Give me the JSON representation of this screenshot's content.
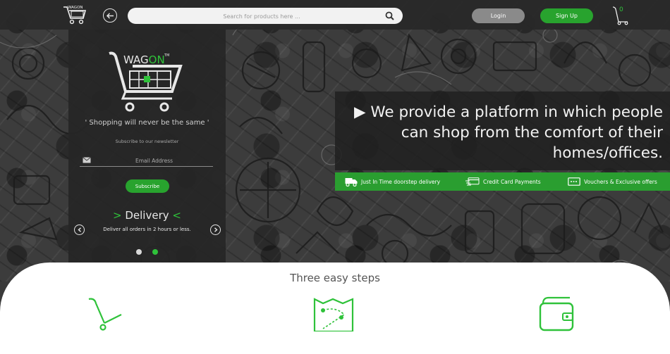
{
  "header": {
    "back_label": "back",
    "search_placeholder": "Search for products here ...",
    "login_label": "Login",
    "signup_label": "Sign Up",
    "cart_count": "0",
    "logo_text_small": "WAGON"
  },
  "panel": {
    "logo_text_prefix": "WAG",
    "logo_text_suffix": "ON",
    "logo_tm": "TM",
    "tagline": "' Shopping will never be the same '",
    "subscribe_label": "Subscribe to our newsletter",
    "email_placeholder": "Email Address",
    "subscribe_button": "Subscribe",
    "slide": {
      "title_left": ">",
      "title": "Delivery",
      "title_right": "<",
      "text": "Deliver all orders in 2 hours or less."
    },
    "carousel_active_index": 2
  },
  "promo": {
    "text": "▶ We provide a platform in which people can shop from the comfort of their homes/offices."
  },
  "features": [
    {
      "label": "Just In Time doorstep delivery",
      "icon": "truck-icon"
    },
    {
      "label": "Credit Card Payments",
      "icon": "credit-card-icon"
    },
    {
      "label": "Vouchers & Exclusive offers",
      "icon": "voucher-icon"
    }
  ],
  "steps": {
    "title": "Three easy steps",
    "icons": [
      "hand-truck-icon",
      "map-route-icon",
      "wallet-icon"
    ]
  },
  "colors": {
    "accent_green": "#28a32e",
    "topbar": "#282828",
    "panel": "#262626"
  }
}
